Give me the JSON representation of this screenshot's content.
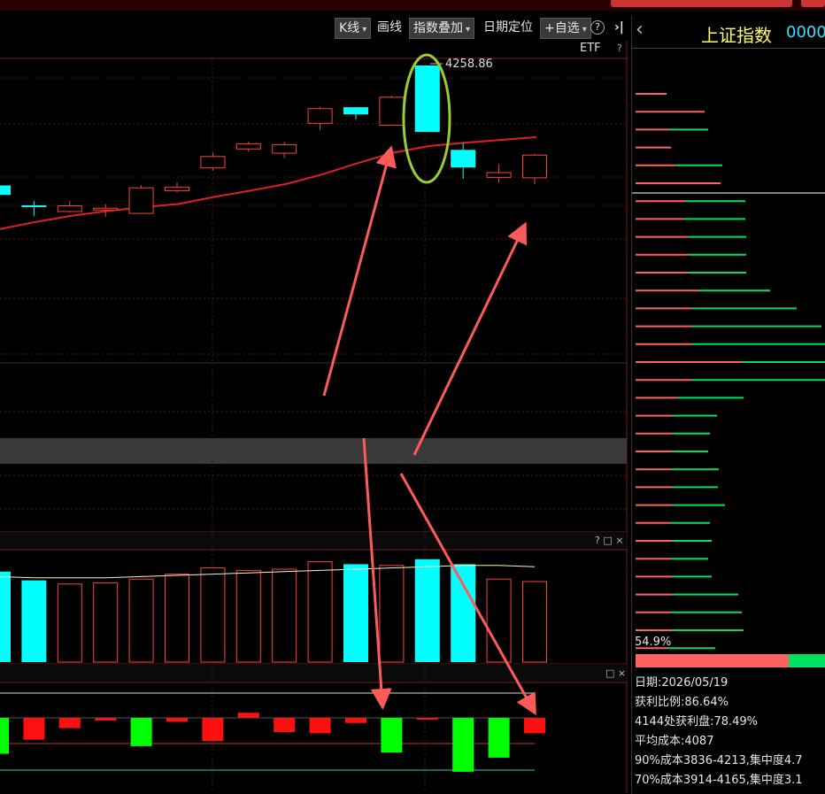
{
  "toolbar": {
    "kline_label": "K线",
    "draw_label": "画线",
    "index_overlay_label": "指数叠加",
    "date_locate_label": "日期定位",
    "watchlist_label": "+自选",
    "help_glyph": "?",
    "collapse_glyph": "›|",
    "etf_label": "ETF",
    "etf_help": "?"
  },
  "right_panel": {
    "back_glyph": "‹",
    "index_name": "上证指数",
    "index_code": "0000",
    "percent_label": "54.9%",
    "info_lines": [
      "日期:2026/05/19",
      "获利比例:86.64%",
      "4144处获利盘:78.49%",
      "平均成本:4087",
      "90%成本3836-4213,集中度4.7",
      "70%成本3914-4165,集中度3.1"
    ]
  },
  "panels": {
    "volume_controls": "? □ ×",
    "macd_controls": "□ ×"
  },
  "chart_data": {
    "type": "candlestick",
    "high_label": "4258.86",
    "candles": [
      {
        "o": 4005,
        "c": 3985,
        "h": 4005,
        "l": 3985,
        "color": "cyan"
      },
      {
        "o": 3963,
        "c": 3963,
        "h": 3972,
        "l": 3941,
        "color": "cyan"
      },
      {
        "o": 3950,
        "c": 3962,
        "h": 3972,
        "l": 3947,
        "color": "red"
      },
      {
        "o": 3954,
        "c": 3957,
        "h": 3965,
        "l": 3939,
        "color": "red"
      },
      {
        "o": 3946,
        "c": 4000,
        "h": 4005,
        "l": 3946,
        "color": "red"
      },
      {
        "o": 3994,
        "c": 4001,
        "h": 4011,
        "l": 3990,
        "color": "red"
      },
      {
        "o": 4042,
        "c": 4066,
        "h": 4074,
        "l": 4036,
        "color": "red"
      },
      {
        "o": 4082,
        "c": 4093,
        "h": 4097,
        "l": 4076,
        "color": "red"
      },
      {
        "o": 4073,
        "c": 4091,
        "h": 4097,
        "l": 4063,
        "color": "red"
      },
      {
        "o": 4136,
        "c": 4167,
        "h": 4171,
        "l": 4122,
        "color": "red"
      },
      {
        "o": 4170,
        "c": 4155,
        "h": 4170,
        "l": 4144,
        "color": "cyan"
      },
      {
        "o": 4132,
        "c": 4191,
        "h": 4194,
        "l": 4131,
        "color": "red"
      },
      {
        "o": 4258,
        "c": 4118,
        "h": 4258,
        "l": 4118,
        "color": "cyan"
      },
      {
        "o": 4080,
        "c": 4043,
        "h": 4095,
        "l": 4019,
        "color": "cyan"
      },
      {
        "o": 4022,
        "c": 4032,
        "h": 4050,
        "l": 4011,
        "color": "red"
      },
      {
        "o": 4021,
        "c": 4069,
        "h": 4072,
        "l": 4008,
        "color": "red"
      }
    ],
    "ma_line": [
      3913,
      3928,
      3941,
      3951,
      3959,
      3966,
      3981,
      3994,
      4008,
      4028,
      4052,
      4074,
      4088,
      4095,
      4101,
      4107
    ],
    "volume": [
      {
        "v": 78,
        "color": "cyan"
      },
      {
        "v": 71,
        "color": "cyan"
      },
      {
        "v": 68,
        "color": "red"
      },
      {
        "v": 69,
        "color": "red"
      },
      {
        "v": 72,
        "color": "red"
      },
      {
        "v": 76,
        "color": "red"
      },
      {
        "v": 81,
        "color": "red"
      },
      {
        "v": 79,
        "color": "red"
      },
      {
        "v": 80,
        "color": "red"
      },
      {
        "v": 86,
        "color": "red"
      },
      {
        "v": 84,
        "color": "cyan"
      },
      {
        "v": 83,
        "color": "red"
      },
      {
        "v": 88,
        "color": "cyan"
      },
      {
        "v": 84,
        "color": "cyan"
      },
      {
        "v": 72,
        "color": "red"
      },
      {
        "v": 70,
        "color": "red"
      }
    ],
    "volume_ma": [
      74,
      73,
      73,
      73,
      74,
      75,
      76,
      77,
      78,
      79,
      80,
      81,
      82,
      83,
      83,
      82
    ],
    "macd": [
      -28,
      -17,
      -8,
      -2,
      -22,
      -3,
      -18,
      4,
      -11,
      -12,
      -4,
      -27,
      -1,
      -42,
      -31,
      -12
    ],
    "macd_colors": [
      "green",
      "red",
      "red",
      "red",
      "green",
      "red",
      "red",
      "red",
      "red",
      "red",
      "red",
      "green",
      "red",
      "green",
      "green",
      "red"
    ],
    "ylim": [
      3840,
      4275
    ]
  }
}
